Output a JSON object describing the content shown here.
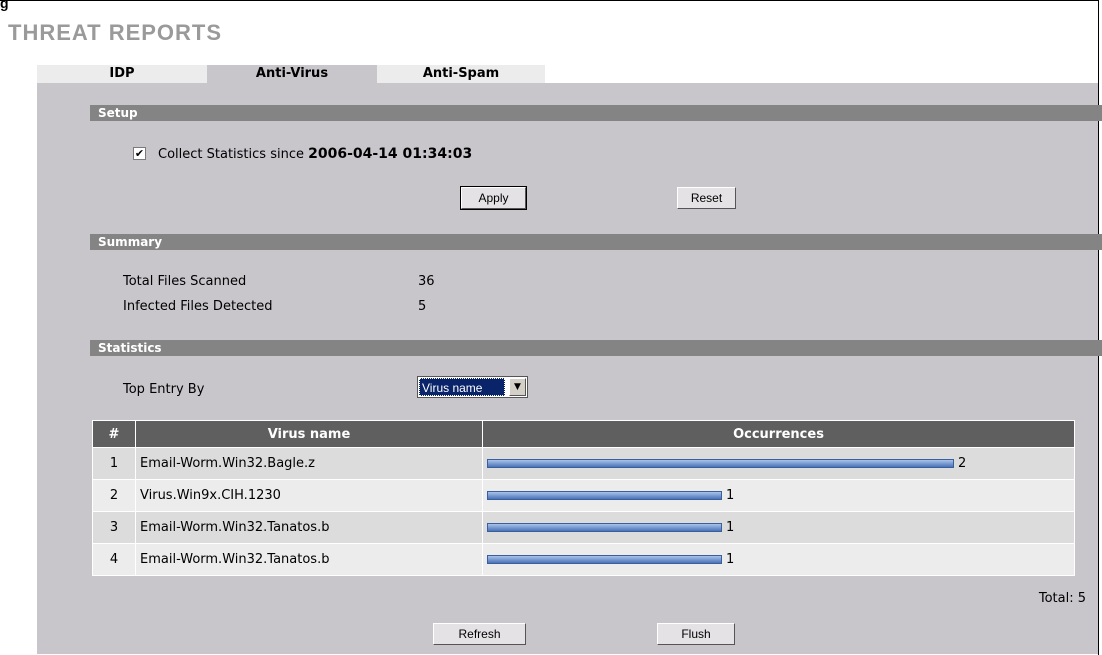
{
  "figure_label": "g",
  "page_title": "THREAT REPORTS",
  "tabs": [
    {
      "label": "IDP",
      "active": false
    },
    {
      "label": "Anti-Virus",
      "active": true
    },
    {
      "label": "Anti-Spam",
      "active": false
    }
  ],
  "setup": {
    "section_title": "Setup",
    "collect_checked": true,
    "collect_label": "Collect Statistics since",
    "since_value": "2006-04-14 01:34:03",
    "apply_label": "Apply",
    "reset_label": "Reset"
  },
  "summary": {
    "section_title": "Summary",
    "total_files_label": "Total Files Scanned",
    "total_files_value": "36",
    "infected_label": "Infected Files Detected",
    "infected_value": "5"
  },
  "statistics": {
    "section_title": "Statistics",
    "top_entry_label": "Top Entry By",
    "top_entry_selected": "Virus name",
    "columns": [
      "#",
      "Virus name",
      "Occurrences"
    ],
    "max_occurrences": 2,
    "rows": [
      {
        "index": "1",
        "name": "Email-Worm.Win32.Bagle.z",
        "occurrences": 2
      },
      {
        "index": "2",
        "name": "Virus.Win9x.CIH.1230",
        "occurrences": 1
      },
      {
        "index": "3",
        "name": "Email-Worm.Win32.Tanatos.b",
        "occurrences": 1
      },
      {
        "index": "4",
        "name": "Email-Worm.Win32.Tanatos.b",
        "occurrences": 1
      }
    ],
    "total_text": "Total: 5",
    "refresh_label": "Refresh",
    "flush_label": "Flush"
  },
  "colors": {
    "panel_bg": "#c8c5cb",
    "section_bar": "#848484",
    "header_bg": "#5f5f5f",
    "bar_fill": "#4a72b6"
  }
}
